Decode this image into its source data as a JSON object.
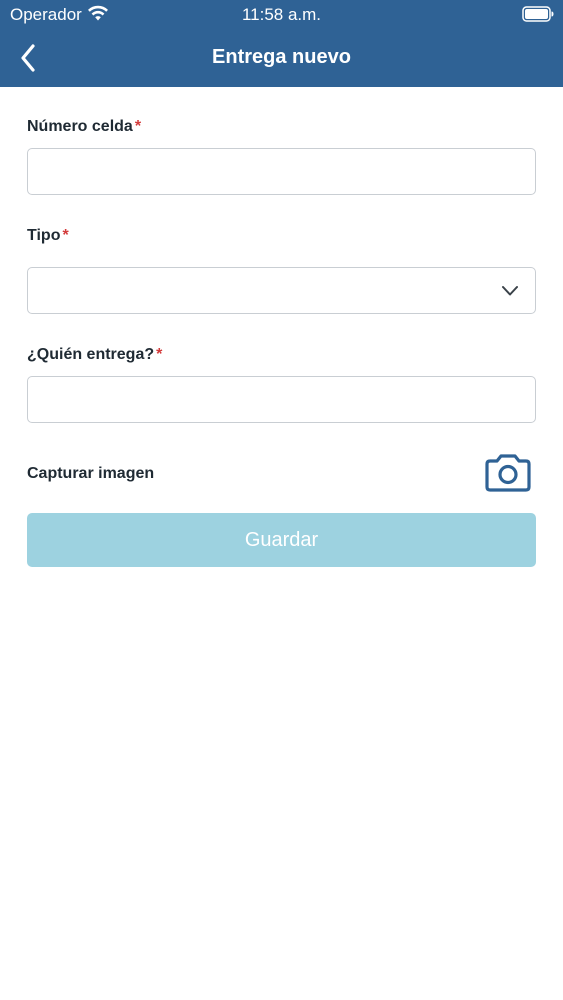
{
  "status_bar": {
    "carrier": "Operador",
    "time": "11:58 a.m.",
    "wifi_icon": "wifi-icon",
    "battery_icon": "battery-icon"
  },
  "nav": {
    "title": "Entrega nuevo",
    "back_icon": "chevron-left-icon"
  },
  "form": {
    "cell_number": {
      "label": "Número celda",
      "required_mark": "*",
      "value": "",
      "placeholder": ""
    },
    "type": {
      "label": "Tipo",
      "required_mark": "*",
      "selected": "",
      "icon": "chevron-down-icon"
    },
    "who_delivers": {
      "label": "¿Quién entrega?",
      "required_mark": "*",
      "value": "",
      "placeholder": ""
    },
    "capture": {
      "label": "Capturar imagen",
      "icon": "camera-icon"
    },
    "save_label": "Guardar",
    "save_enabled": false
  },
  "colors": {
    "header": "#2f6295",
    "required": "#d33b3b",
    "save_button_disabled": "#9dd2e0",
    "camera_icon": "#2f6295",
    "input_border": "#c9ced3"
  }
}
